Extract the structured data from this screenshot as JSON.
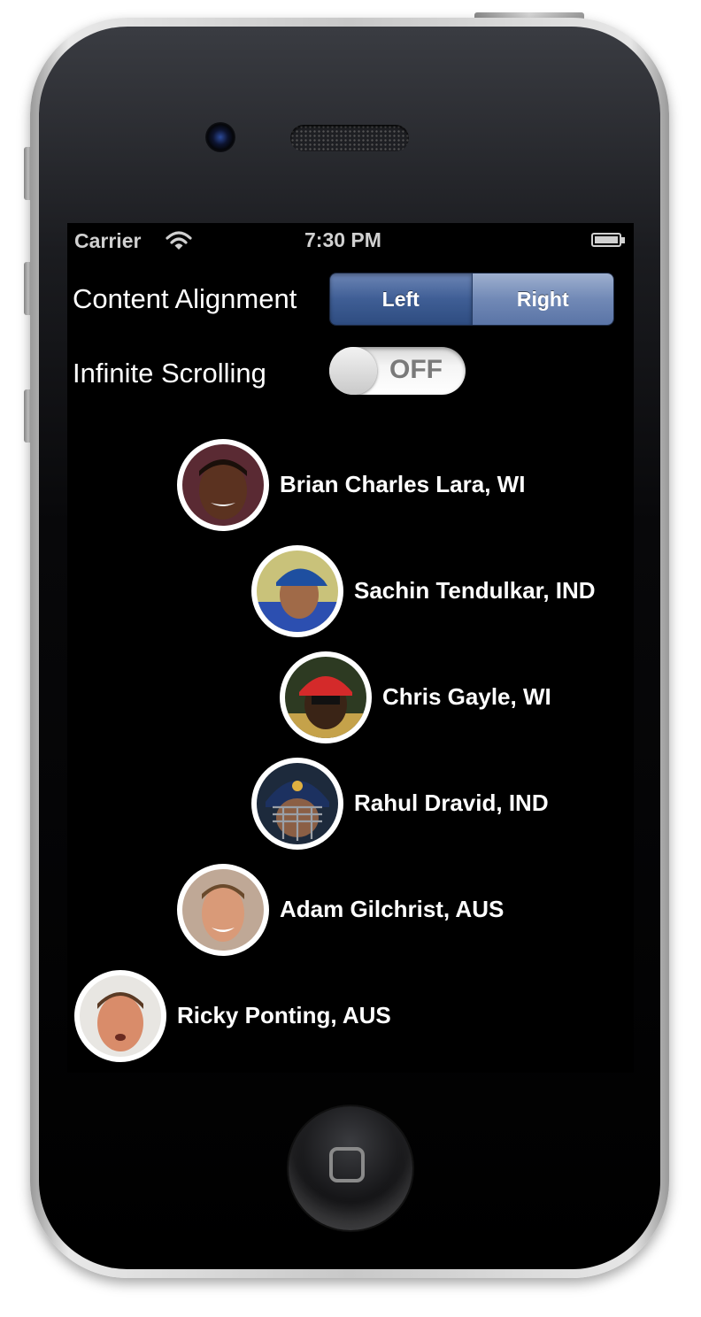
{
  "status_bar": {
    "carrier": "Carrier",
    "time": "7:30 PM"
  },
  "controls": {
    "alignment_label": "Content Alignment",
    "alignment_options": [
      "Left",
      "Right"
    ],
    "alignment_selected": "Left",
    "scrolling_label": "Infinite Scrolling",
    "scrolling_state": "OFF"
  },
  "players": [
    {
      "name": "Brian Charles Lara, WI"
    },
    {
      "name": "Sachin Tendulkar, IND"
    },
    {
      "name": "Chris Gayle, WI"
    },
    {
      "name": "Rahul Dravid, IND"
    },
    {
      "name": "Adam Gilchrist, AUS"
    },
    {
      "name": "Ricky Ponting, AUS"
    }
  ]
}
